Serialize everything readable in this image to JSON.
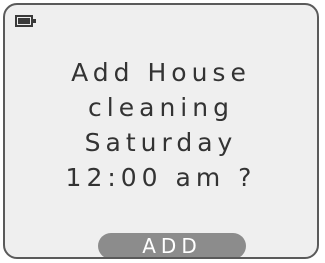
{
  "status_bar": {
    "battery_icon": "battery-full-icon"
  },
  "prompt": {
    "line1": "Add House",
    "line2": "cleaning",
    "line3": "Saturday",
    "line4": "12:00 am ?"
  },
  "actions": {
    "add_label": "ADD"
  },
  "colors": {
    "screen_background": "#efefef",
    "text": "#333333",
    "button_background": "#8c8c8c",
    "button_text": "#ffffff"
  }
}
